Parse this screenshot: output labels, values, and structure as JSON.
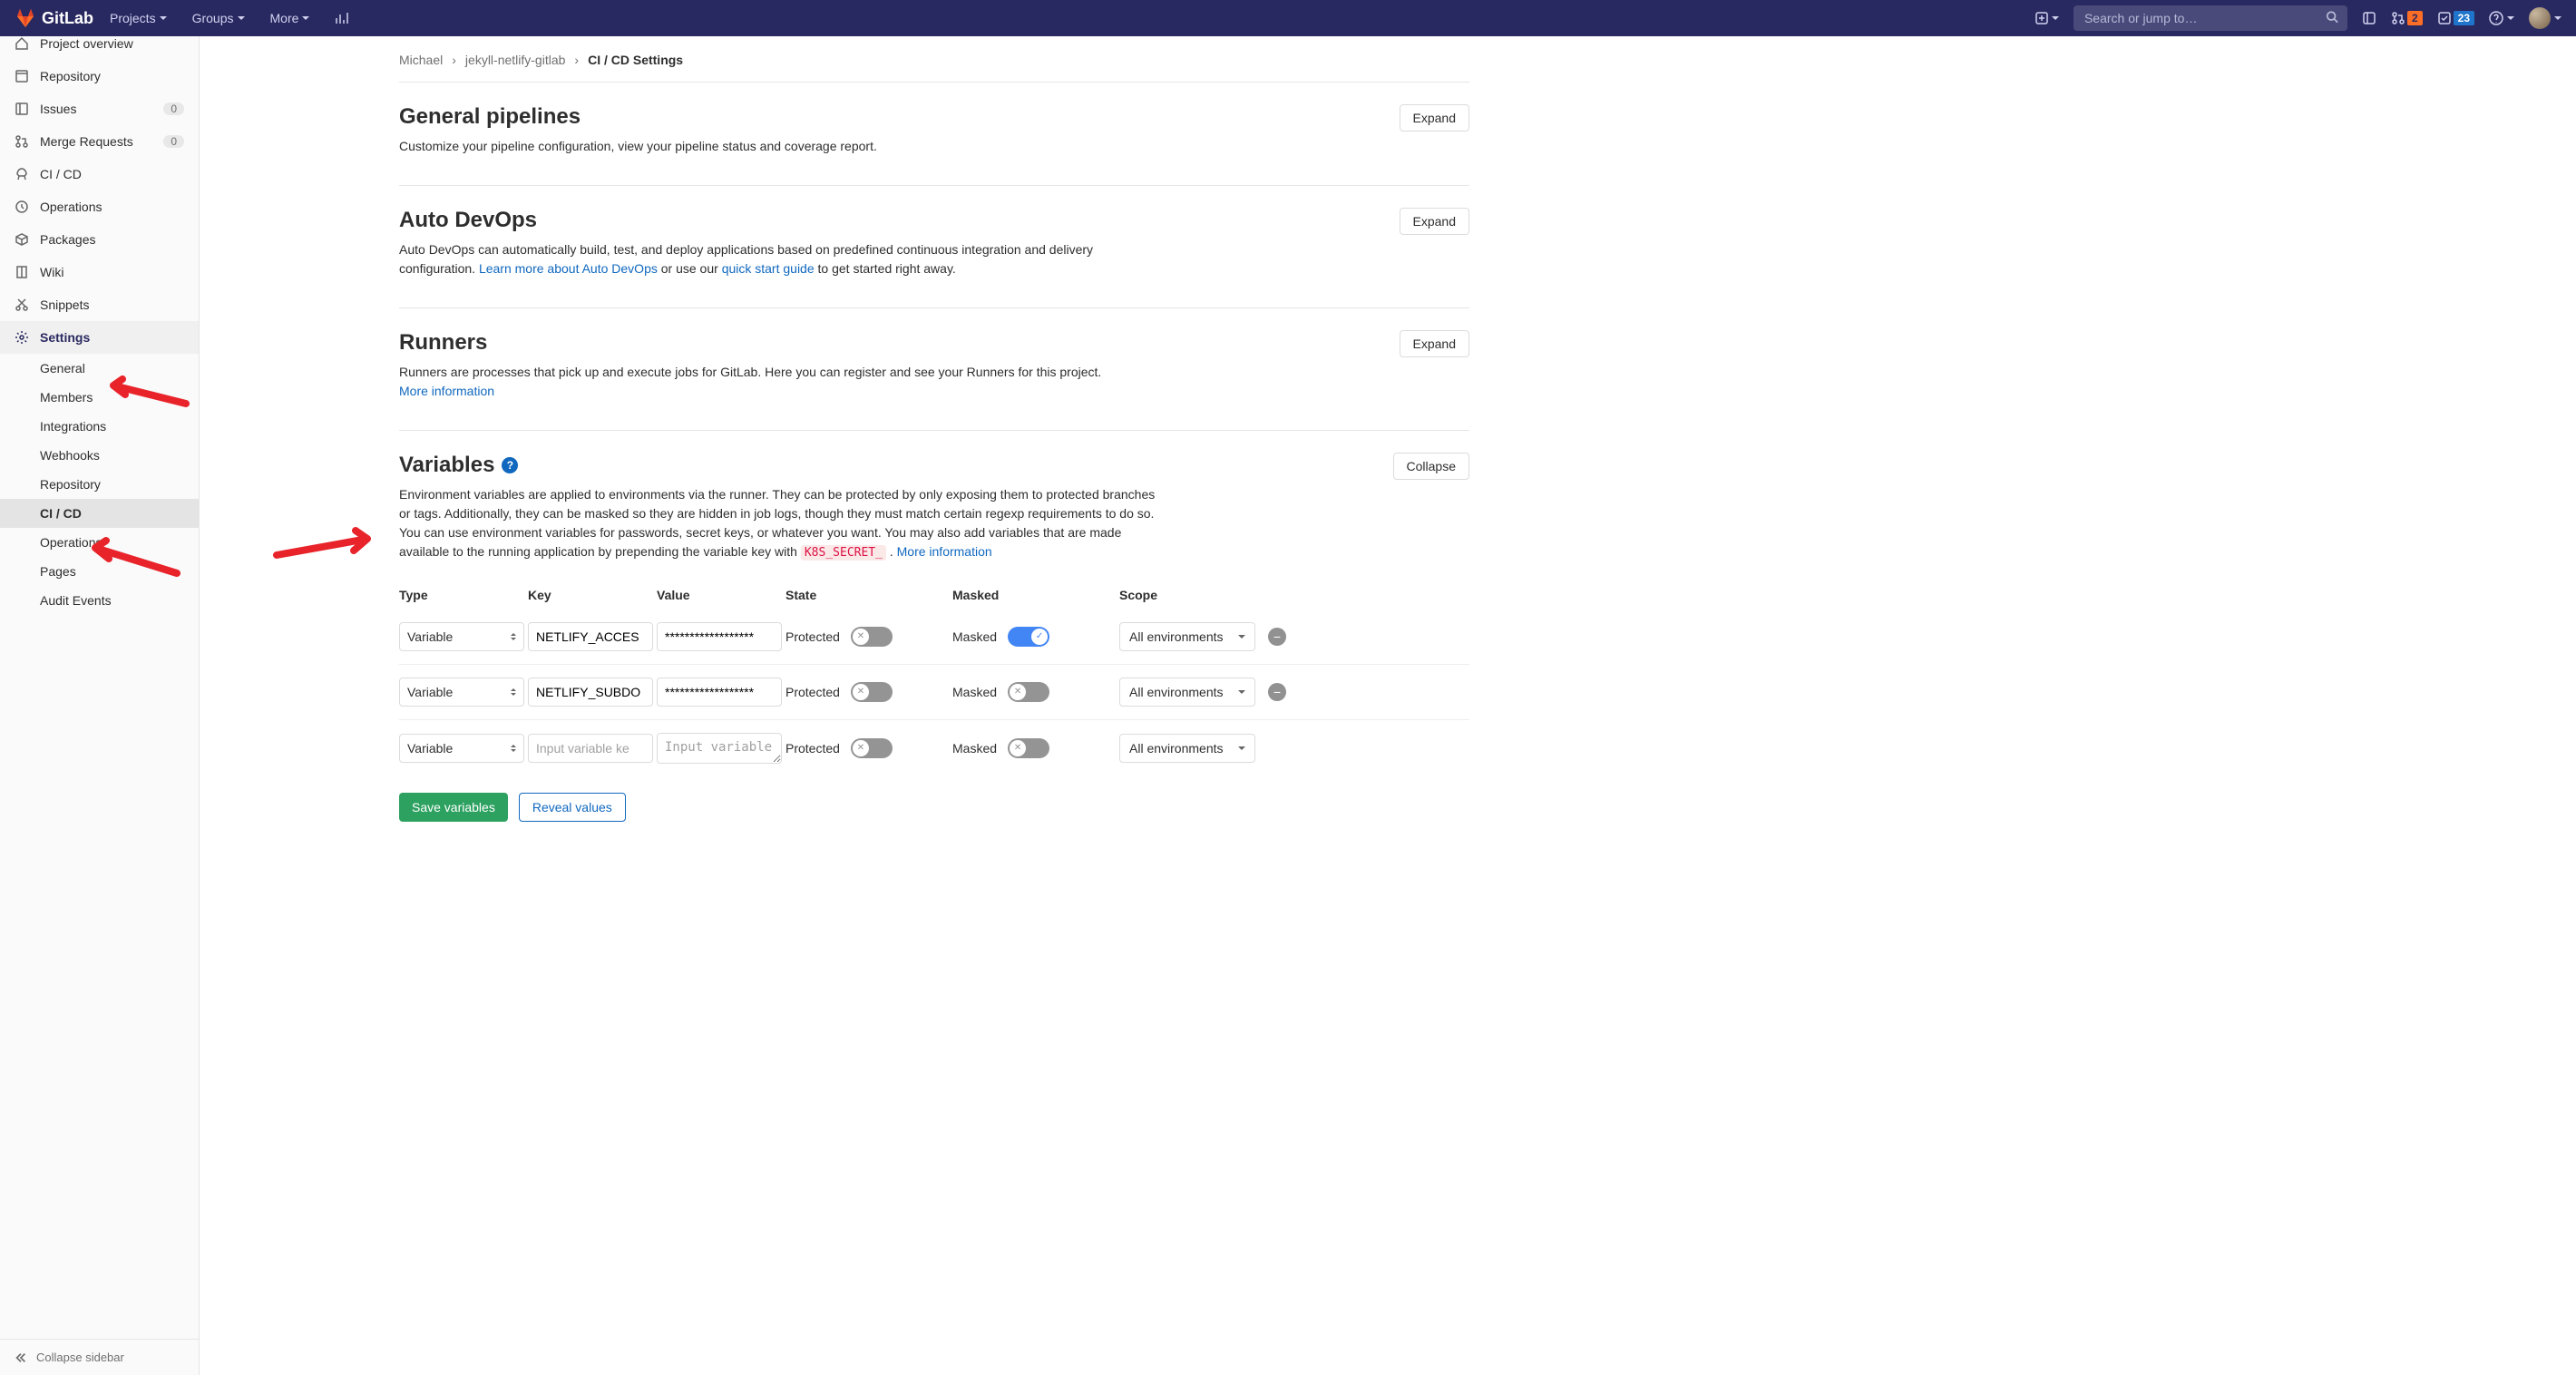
{
  "header": {
    "brand": "GitLab",
    "nav": [
      "Projects",
      "Groups",
      "More"
    ],
    "search_placeholder": "Search or jump to…",
    "merge_requests_count": "2",
    "todos_count": "23"
  },
  "breadcrumb": {
    "items": [
      "Michael",
      "jekyll-netlify-gitlab"
    ],
    "current": "CI / CD Settings"
  },
  "sidebar": {
    "items": [
      {
        "label": "Project overview",
        "icon": "home"
      },
      {
        "label": "Repository",
        "icon": "repo"
      },
      {
        "label": "Issues",
        "icon": "issues",
        "count": "0"
      },
      {
        "label": "Merge Requests",
        "icon": "merge",
        "count": "0"
      },
      {
        "label": "CI / CD",
        "icon": "rocket"
      },
      {
        "label": "Operations",
        "icon": "ops"
      },
      {
        "label": "Packages",
        "icon": "package"
      },
      {
        "label": "Wiki",
        "icon": "wiki"
      },
      {
        "label": "Snippets",
        "icon": "snippets"
      },
      {
        "label": "Settings",
        "icon": "settings"
      }
    ],
    "sub_items": [
      "General",
      "Members",
      "Integrations",
      "Webhooks",
      "Repository",
      "CI / CD",
      "Operations",
      "Pages",
      "Audit Events"
    ],
    "collapse_label": "Collapse sidebar"
  },
  "sections": {
    "general": {
      "title": "General pipelines",
      "desc": "Customize your pipeline configuration, view your pipeline status and coverage report.",
      "button": "Expand"
    },
    "autodevops": {
      "title": "Auto DevOps",
      "desc_a": "Auto DevOps can automatically build, test, and deploy applications based on predefined continuous integration and delivery configuration. ",
      "link1": "Learn more about Auto DevOps",
      "mid": " or use our ",
      "link2": "quick start guide",
      "end": " to get started right away.",
      "button": "Expand"
    },
    "runners": {
      "title": "Runners",
      "desc": "Runners are processes that pick up and execute jobs for GitLab. Here you can register and see your Runners for this project.",
      "link": "More information",
      "button": "Expand"
    },
    "variables": {
      "title": "Variables",
      "button": "Collapse",
      "desc": "Environment variables are applied to environments via the runner. They can be protected by only exposing them to protected branches or tags. Additionally, they can be masked so they are hidden in job logs, though they must match certain regexp requirements to do so. You can use environment variables for passwords, secret keys, or whatever you want. You may also add variables that are made available to the running application by prepending the variable key with ",
      "code": "K8S_SECRET_",
      "link": "More information",
      "headers": [
        "Type",
        "Key",
        "Value",
        "State",
        "Masked",
        "Scope"
      ],
      "type_label": "Variable",
      "state_label": "Protected",
      "masked_label": "Masked",
      "scope_label": "All environments",
      "key_placeholder": "Input variable ke",
      "value_placeholder": "Input variable",
      "rows": [
        {
          "key": "NETLIFY_ACCES",
          "value": "******************",
          "masked_on": true
        },
        {
          "key": "NETLIFY_SUBDO",
          "value": "******************",
          "masked_on": false
        }
      ],
      "save_label": "Save variables",
      "reveal_label": "Reveal values"
    }
  }
}
